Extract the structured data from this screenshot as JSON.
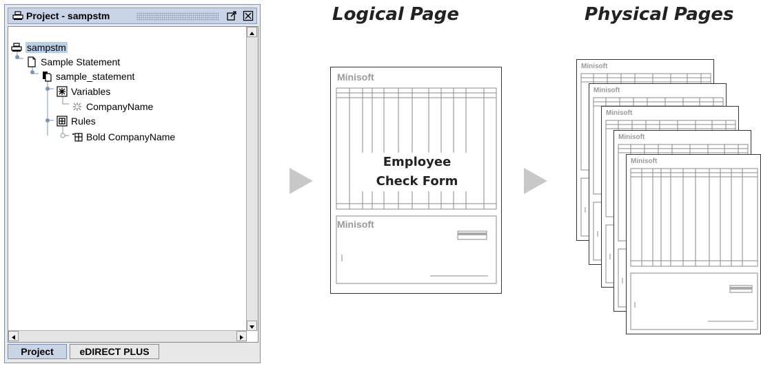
{
  "window": {
    "title": "Project - sampstm",
    "icons": {
      "title": "printer-icon",
      "undock": "undock-icon",
      "close": "close-icon"
    },
    "tree": [
      {
        "label": "sampstm",
        "icon": "printer-icon",
        "selected": true
      },
      {
        "label": "Sample Statement",
        "icon": "document-icon"
      },
      {
        "label": "sample_statement",
        "icon": "documents-icon"
      },
      {
        "label": "Variables",
        "icon": "variables-icon"
      },
      {
        "label": "CompanyName",
        "icon": "variable-icon"
      },
      {
        "label": "Rules",
        "icon": "rules-icon"
      },
      {
        "label": "Bold CompanyName",
        "icon": "rule-icon"
      }
    ],
    "tabs": [
      "Project",
      "eDIRECT PLUS"
    ]
  },
  "diagram": {
    "logical_heading": "Logical Page",
    "physical_heading": "Physical Pages",
    "brand": "Minisoft",
    "center_label": "Employee\nCheck Form",
    "arrow_color": "#c8c8c8"
  }
}
